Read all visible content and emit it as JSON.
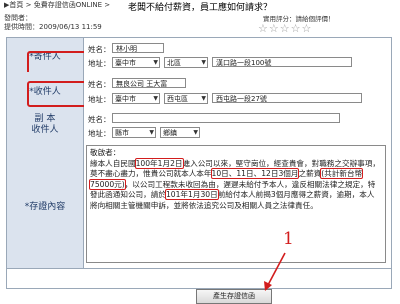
{
  "header": {
    "breadcrumb": "▶首頁 > 免費存證信函ONLINE > ",
    "title": "老闆不給付薪資，員工應如何請求？",
    "author_label": "發問者：",
    "date_label": "提供時間：2009/06/13 11:59",
    "rating_label": "實用評分：請給個評價！",
    "stars": "☆☆☆☆☆"
  },
  "sender": {
    "label": "*寄件人",
    "name_label": "姓名：",
    "name_value": "林小明",
    "address_label": "地址：",
    "city": "臺中市",
    "district": "北區",
    "street": "漢口路一段100號"
  },
  "recipient": {
    "label": "*收件人",
    "name_label": "姓名：",
    "name_value": "無良公司 王大富",
    "address_label": "地址：",
    "city": "臺中市",
    "district": "西屯區",
    "street": "西屯路一段27號"
  },
  "cc": {
    "label": "副 本\n收件人",
    "name_label": "姓名：",
    "name_value": "",
    "address_label": "地址：",
    "city": "縣市",
    "district": "鄉鎮"
  },
  "content": {
    "label": "*存證內容",
    "greeting": "敬啟者：",
    "p1": "緣本人自民國",
    "h1": "100年1月2日",
    "p2": "進入公司以來，堅守崗位，經查貴會，對職務之交辦",
    "p3": "事項，莫不盡心盡力，惟貴公司就本人本年",
    "h2": "10日、11日、12日3個月",
    "p4": "之薪資",
    "h3": "(共計新台幣75000元)",
    "p5": "，以公司工程款未收回為由，遲遲未給付予本人，違反相關法律之規定，特發此函通知公司，請於",
    "h4": "101年1月30日",
    "p6": "前給付本人前揭3個月應得之薪資，逾期，本人將向相關主管機關申訴，並將依法追究公司及相關人員之法律責任。"
  },
  "submit": {
    "label": "產生存證信函"
  },
  "annotation": {
    "number": "1"
  }
}
